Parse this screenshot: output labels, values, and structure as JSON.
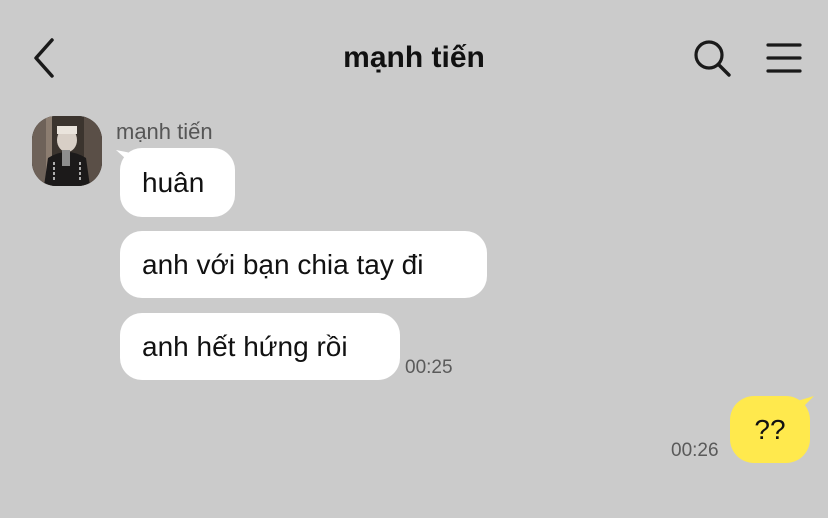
{
  "header": {
    "title": "mạnh tiến",
    "back_icon": "chevron-left-icon",
    "search_icon": "search-icon",
    "menu_icon": "hamburger-menu-icon"
  },
  "chat": {
    "sender_name": "mạnh tiến",
    "incoming": [
      {
        "text": "huân"
      },
      {
        "text": "anh với bạn chia tay đi"
      },
      {
        "text": "anh hết hứng rồi",
        "time": "00:25"
      }
    ],
    "outgoing": [
      {
        "text": "??",
        "time": "00:26"
      }
    ]
  },
  "colors": {
    "background": "#cbcbcb",
    "incoming_bubble": "#ffffff",
    "outgoing_bubble": "#ffe94d",
    "text": "#111111",
    "meta_text": "#5a5a5a"
  }
}
